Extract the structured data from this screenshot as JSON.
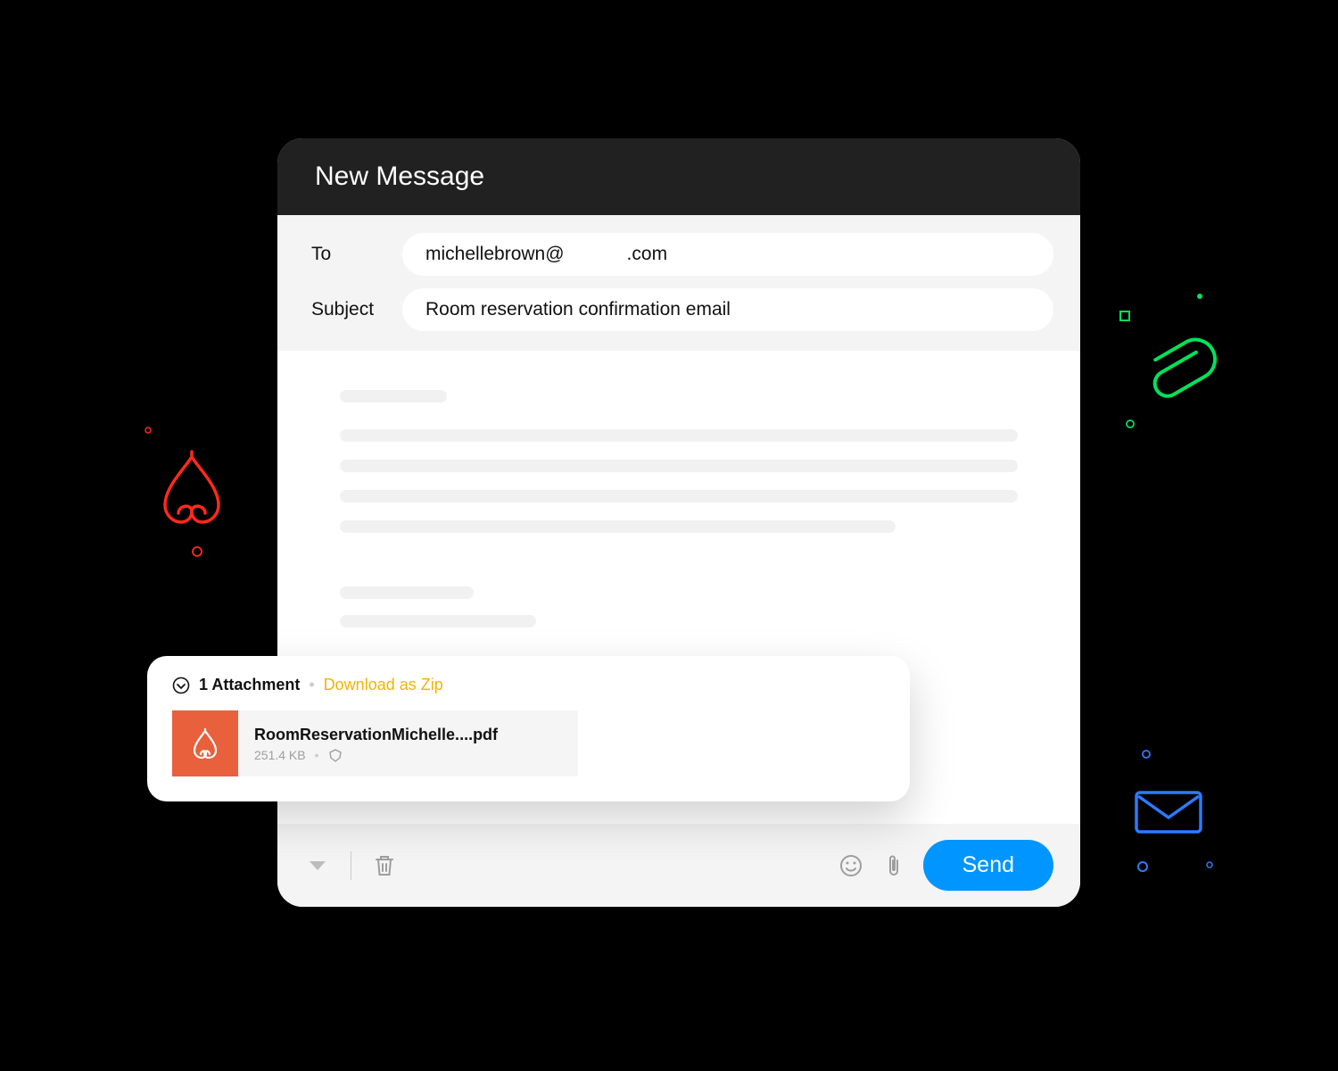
{
  "compose": {
    "title": "New Message",
    "fields": {
      "to_label": "To",
      "to_value": "michellebrown@            .com",
      "subject_label": "Subject",
      "subject_value": "Room reservation confirmation email"
    },
    "toolbar": {
      "send_label": "Send"
    }
  },
  "attachment": {
    "count_label": "1 Attachment",
    "download_label": "Download as Zip",
    "item": {
      "name": "RoomReservationMichelle....pdf",
      "size": "251.4 KB"
    }
  }
}
